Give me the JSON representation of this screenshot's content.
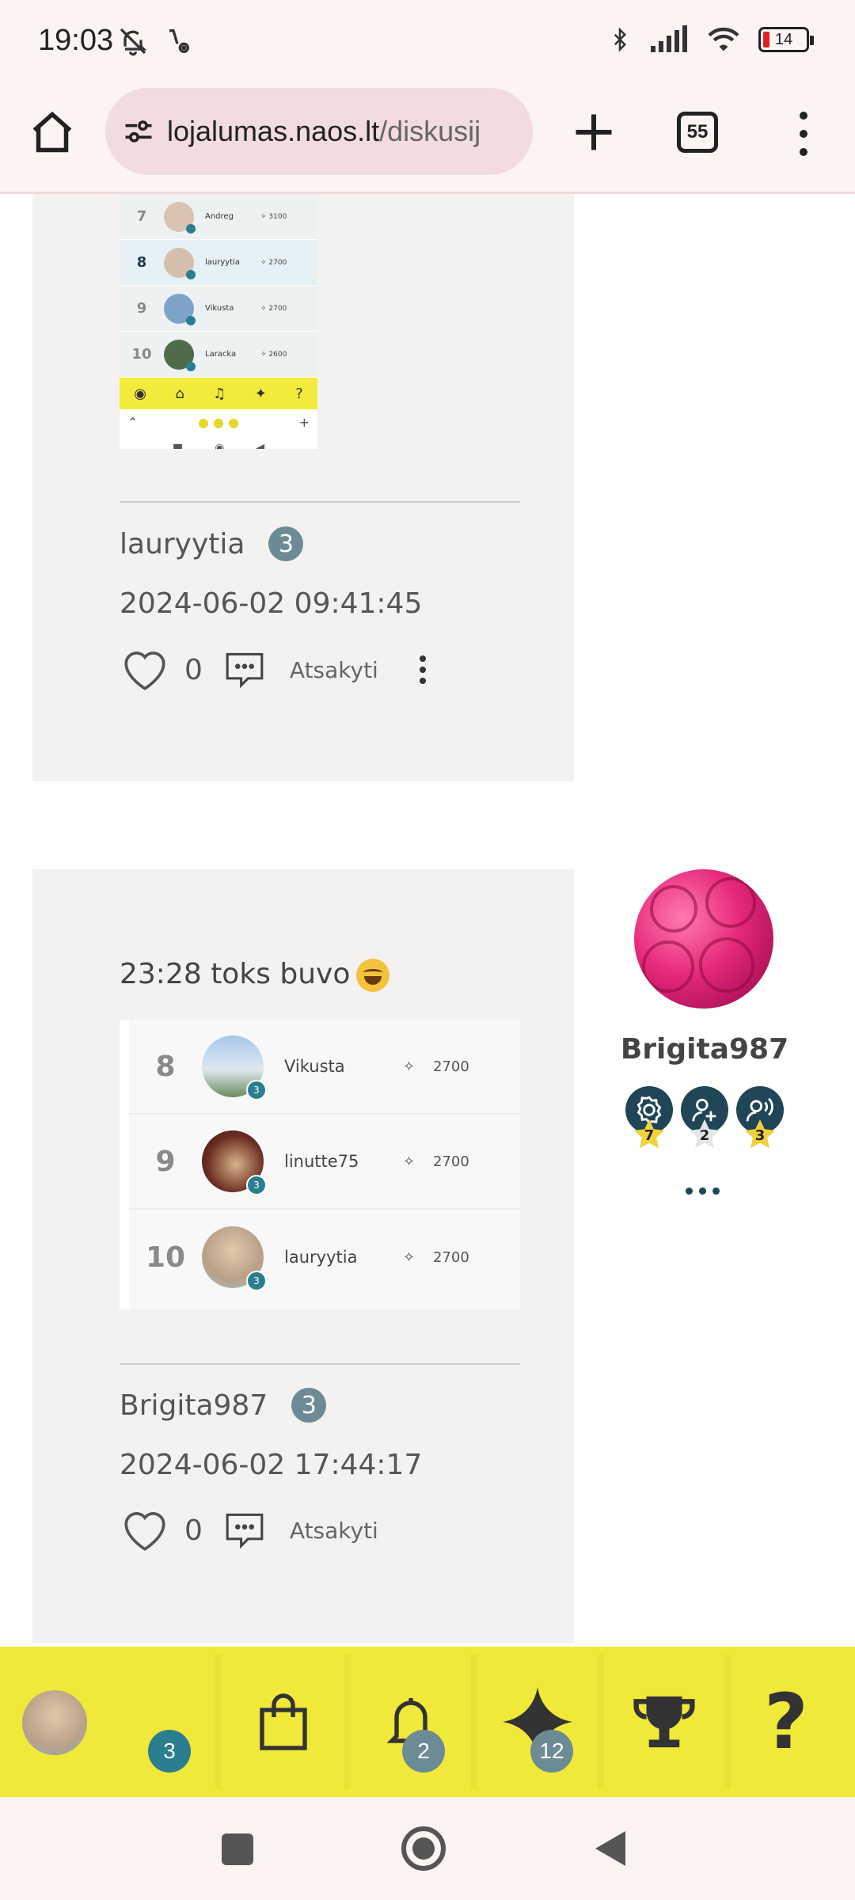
{
  "status_bar": {
    "time": "19:03",
    "battery": "14"
  },
  "browser": {
    "url_host": "lojalumas.naos.lt",
    "url_path": "/diskusij",
    "tab_count": "55"
  },
  "posts": [
    {
      "thumbnail": {
        "rows": [
          {
            "rank": "7",
            "name": "Andreg",
            "points": "3100"
          },
          {
            "rank": "8",
            "name": "lauryytia",
            "points": "2700"
          },
          {
            "rank": "9",
            "name": "Vikusta",
            "points": "2700"
          },
          {
            "rank": "10",
            "name": "Laracka",
            "points": "2600"
          }
        ],
        "nav_question": "?",
        "nav_plus": "+"
      },
      "author": "lauryytia",
      "level": "3",
      "date": "2024-06-02 09:41:45",
      "likes": "0",
      "reply_label": "Atsakyti"
    },
    {
      "text": "23:28 toks buvo",
      "leaderboard": [
        {
          "rank": "8",
          "name": "Vikusta",
          "points": "2700",
          "level": "3"
        },
        {
          "rank": "9",
          "name": "linutte75",
          "points": "2700",
          "level": "3"
        },
        {
          "rank": "10",
          "name": "lauryytia",
          "points": "2700",
          "level": "3"
        }
      ],
      "author": "Brigita987",
      "level": "3",
      "date": "2024-06-02 17:44:17",
      "likes": "0",
      "reply_label": "Atsakyti"
    }
  ],
  "author_panel": {
    "name": "Brigita987",
    "achievements": [
      {
        "icon": "badge-gear-icon",
        "count": "7",
        "star": "gold"
      },
      {
        "icon": "add-user-icon",
        "count": "2",
        "star": "silver"
      },
      {
        "icon": "broadcast-user-icon",
        "count": "3",
        "star": "gold"
      }
    ]
  },
  "app_bar": {
    "profile_badge": "3",
    "notifications_badge": "2",
    "points_badge": "12",
    "help_label": "?"
  },
  "colors": {
    "app_bar_bg": "#f0e93a",
    "badge_gray": "#6d8b94",
    "badge_teal": "#2b7e8f",
    "card_bg": "#f3f2f1"
  }
}
